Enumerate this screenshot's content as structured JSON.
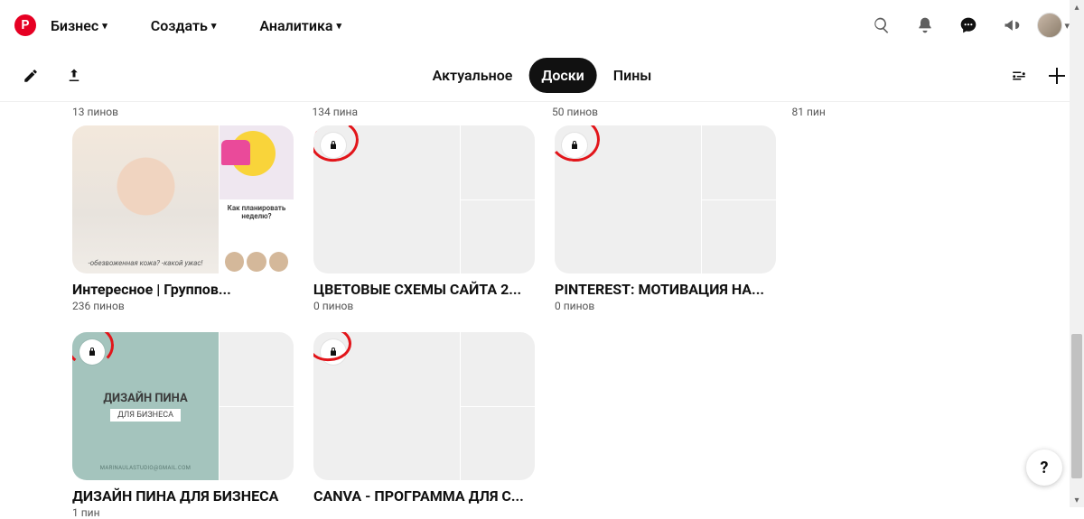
{
  "header": {
    "logo_letter": "P",
    "nav": {
      "business": "Бизнес",
      "create": "Создать",
      "analytics": "Аналитика"
    }
  },
  "tabs": {
    "relevant": "Актуальное",
    "boards": "Доски",
    "pins": "Пины",
    "active": "boards"
  },
  "top_counts": [
    "13 пинов",
    "134 пина",
    "50 пинов",
    "81 пин"
  ],
  "boards": [
    {
      "title": "Интересное | Группов...",
      "sub": "236 пинов",
      "locked": false,
      "main_caption": "-обезвоженная кожа? -какой ужас!",
      "side2_title": "Как планировать неделю?"
    },
    {
      "title": "ЦВЕТОВЫЕ СХЕМЫ САЙТА 2...",
      "sub": "0 пинов",
      "locked": true
    },
    {
      "title": "PINTEREST: МОТИВАЦИЯ НА...",
      "sub": "0 пинов",
      "locked": true
    },
    {
      "title": "ДИЗАЙН ПИНА ДЛЯ БИЗНЕСА",
      "sub": "1 пин",
      "locked": true,
      "card_title": "ДИЗАЙН ПИНА",
      "card_sub": "ДЛЯ БИЗНЕСА",
      "card_brand": "MARINAULASTUDIO@GMAIL.COM"
    },
    {
      "title": "CANVA - ПРОГРАММА ДЛЯ С...",
      "sub": "",
      "locked": true
    }
  ],
  "help": "?"
}
